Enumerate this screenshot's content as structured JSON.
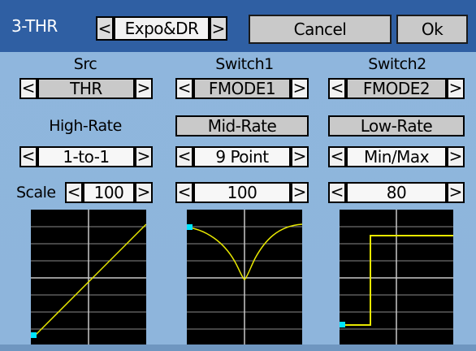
{
  "header": {
    "title": "3-THR",
    "page_left_arrow": "<",
    "page_label": "Expo&DR",
    "page_right_arrow": ">",
    "cancel_label": "Cancel",
    "ok_label": "Ok"
  },
  "columns": {
    "src": {
      "heading": "Src",
      "value": "THR",
      "rate_label": "High-Rate",
      "curve_type": "1-to-1",
      "scale_label": "Scale",
      "scale_value": "100"
    },
    "switch1": {
      "heading": "Switch1",
      "value": "FMODE1",
      "rate_label": "Mid-Rate",
      "curve_type": "9 Point",
      "scale_value": "100"
    },
    "switch2": {
      "heading": "Switch2",
      "value": "FMODE2",
      "rate_label": "Low-Rate",
      "curve_type": "Min/Max",
      "scale_value": "80"
    }
  },
  "arrows": {
    "left": "<",
    "right": ">"
  },
  "colors": {
    "background": "#8fb6dd",
    "titlebar": "#2f5fa3",
    "curve": "#e8e800",
    "marker": "#00e5ff"
  }
}
